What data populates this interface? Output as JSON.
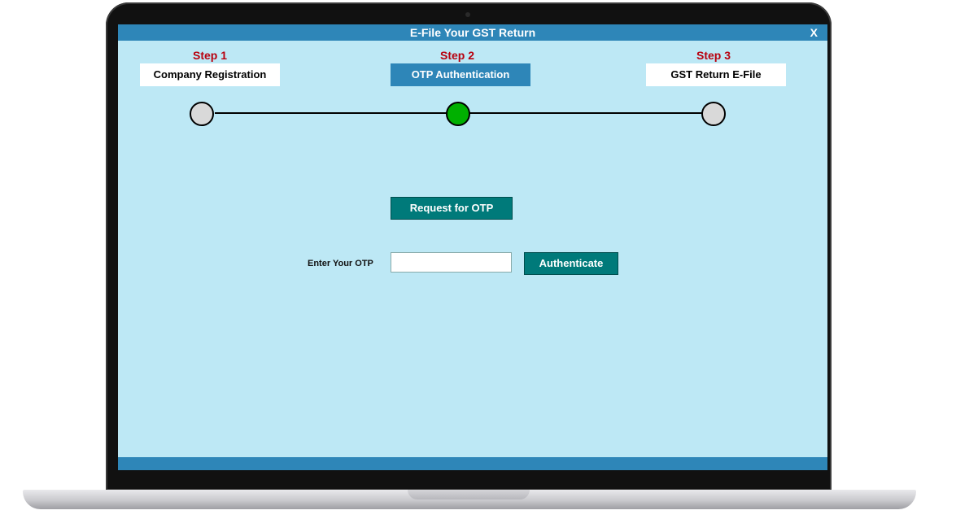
{
  "window": {
    "title": "E-File Your GST Return",
    "close_label": "X"
  },
  "steps": [
    {
      "step": "Step 1",
      "label": "Company Registration",
      "active": false
    },
    {
      "step": "Step 2",
      "label": "OTP Authentication",
      "active": true
    },
    {
      "step": "Step 3",
      "label": "GST Return E-File",
      "active": false
    }
  ],
  "otp": {
    "request_label": "Request for OTP",
    "field_label": "Enter Your OTP",
    "value": "",
    "placeholder": "",
    "authenticate_label": "Authenticate"
  },
  "colors": {
    "title_bar": "#2e86b8",
    "background": "#bde8f5",
    "step_label": "#b8000e",
    "active_node": "#00b000",
    "button": "#007a7a"
  }
}
